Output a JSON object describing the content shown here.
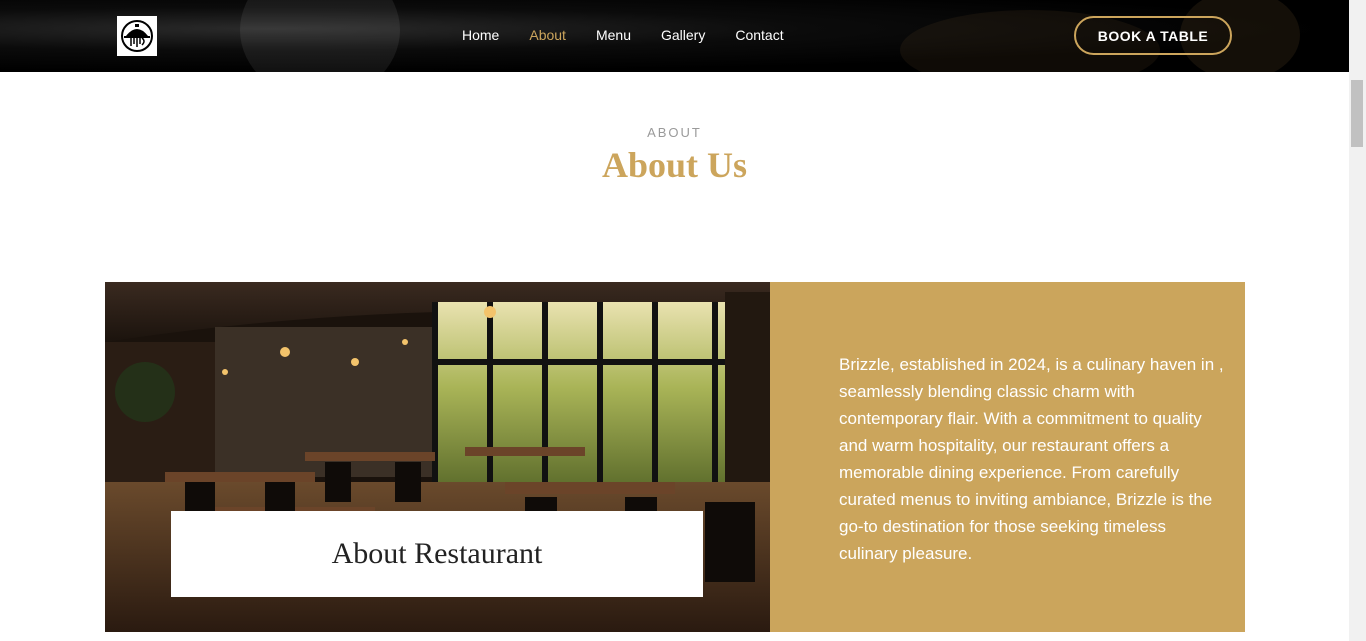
{
  "header": {
    "logo_alt": "Brizzle logo",
    "nav": [
      {
        "label": "Home",
        "active": false
      },
      {
        "label": "About",
        "active": true
      },
      {
        "label": "Menu",
        "active": false
      },
      {
        "label": "Gallery",
        "active": false
      },
      {
        "label": "Contact",
        "active": false
      }
    ],
    "cta_label": "BOOK A TABLE"
  },
  "section": {
    "eyebrow": "ABOUT",
    "title": "About Us"
  },
  "about": {
    "image_caption": "About Restaurant",
    "text": "Brizzle, established in 2024, is a culinary haven in , seamlessly blending classic charm with contemporary flair. With a commitment to quality and warm hospitality, our restaurant offers a memorable dining experience. From carefully curated menus to inviting ambiance, Brizzle is the go-to destination for those seeking timeless culinary pleasure."
  },
  "colors": {
    "accent": "#cca55c",
    "header_bg": "#000000",
    "panel_bg": "#cba55c"
  }
}
